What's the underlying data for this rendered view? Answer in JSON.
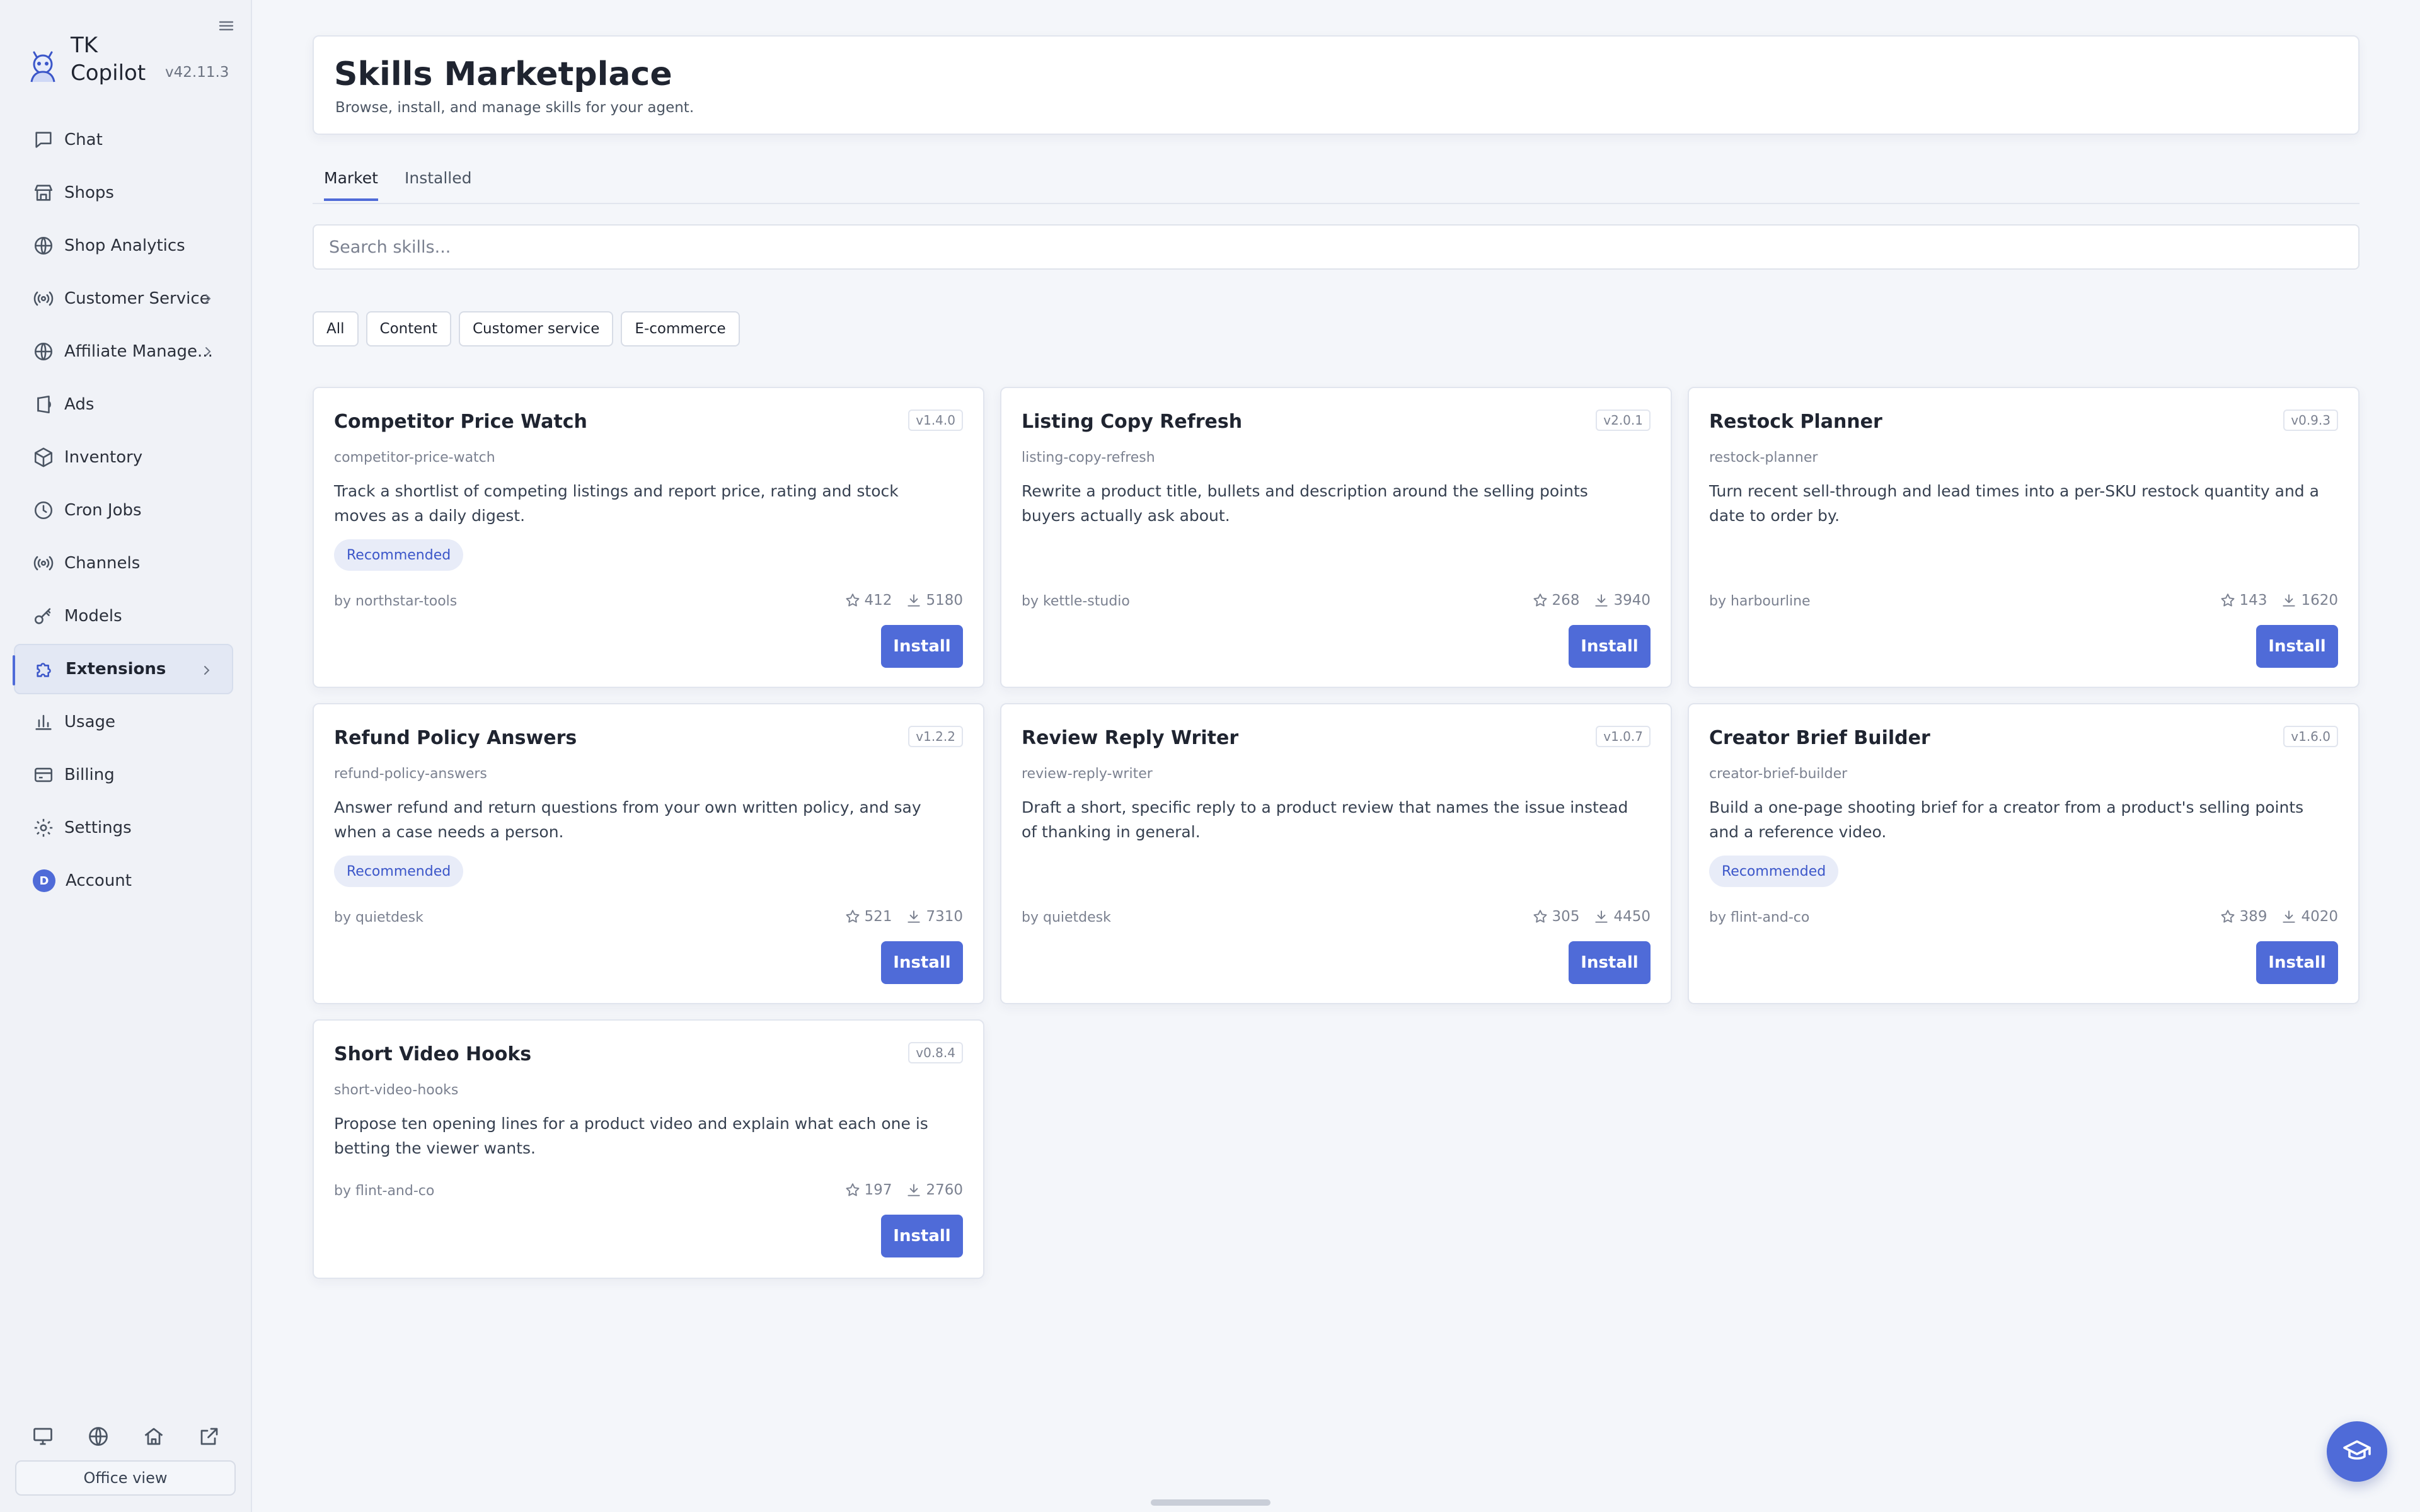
{
  "app": {
    "name": "TK Copilot",
    "version": "v42.11.3"
  },
  "sidebar": {
    "items": [
      {
        "label": "Chat",
        "icon": "chat-bubble-icon"
      },
      {
        "label": "Shops",
        "icon": "storefront-icon"
      },
      {
        "label": "Shop Analytics",
        "icon": "globe-icon"
      },
      {
        "label": "Customer Service",
        "icon": "broadcast-icon",
        "expandable": true
      },
      {
        "label": "Affiliate Manage...",
        "icon": "globe-icon",
        "expandable": true
      },
      {
        "label": "Ads",
        "icon": "megaphone-icon"
      },
      {
        "label": "Inventory",
        "icon": "package-icon"
      },
      {
        "label": "Cron Jobs",
        "icon": "clock-icon"
      },
      {
        "label": "Channels",
        "icon": "broadcast-icon"
      },
      {
        "label": "Models",
        "icon": "key-icon"
      },
      {
        "label": "Extensions",
        "icon": "puzzle-icon",
        "expandable": true,
        "active": true
      },
      {
        "label": "Usage",
        "icon": "bar-chart-icon"
      },
      {
        "label": "Billing",
        "icon": "credit-card-icon"
      },
      {
        "label": "Settings",
        "icon": "gear-icon"
      },
      {
        "label": "Account",
        "icon": "avatar",
        "avatar_initial": "D"
      }
    ],
    "footer_icons": [
      "monitor-icon",
      "globe-icon",
      "home-icon",
      "external-link-icon"
    ],
    "office_view_label": "Office view"
  },
  "header": {
    "title": "Skills Marketplace",
    "subtitle": "Browse, install, and manage skills for your agent."
  },
  "tabs": [
    {
      "label": "Market",
      "active": true
    },
    {
      "label": "Installed",
      "active": false
    }
  ],
  "search": {
    "placeholder": "Search skills...",
    "value": ""
  },
  "filters": [
    "All",
    "Content",
    "Customer service",
    "E-commerce"
  ],
  "cards": [
    {
      "title": "Competitor Price Watch",
      "version": "v1.4.0",
      "slug": "competitor-price-watch",
      "description": "Track a shortlist of competing listings and report price, rating and stock moves as a daily digest.",
      "badge": "Recommended",
      "author": "by northstar-tools",
      "stars": "412",
      "downloads": "5180",
      "button": "Install"
    },
    {
      "title": "Listing Copy Refresh",
      "version": "v2.0.1",
      "slug": "listing-copy-refresh",
      "description": "Rewrite a product title, bullets and description around the selling points buyers actually ask about.",
      "badge": "",
      "author": "by kettle-studio",
      "stars": "268",
      "downloads": "3940",
      "button": "Install"
    },
    {
      "title": "Restock Planner",
      "version": "v0.9.3",
      "slug": "restock-planner",
      "description": "Turn recent sell-through and lead times into a per-SKU restock quantity and a date to order by.",
      "badge": "",
      "author": "by harbourline",
      "stars": "143",
      "downloads": "1620",
      "button": "Install"
    },
    {
      "title": "Refund Policy Answers",
      "version": "v1.2.2",
      "slug": "refund-policy-answers",
      "description": "Answer refund and return questions from your own written policy, and say when a case needs a person.",
      "badge": "Recommended",
      "author": "by quietdesk",
      "stars": "521",
      "downloads": "7310",
      "button": "Install"
    },
    {
      "title": "Review Reply Writer",
      "version": "v1.0.7",
      "slug": "review-reply-writer",
      "description": "Draft a short, specific reply to a product review that names the issue instead of thanking in general.",
      "badge": "",
      "author": "by quietdesk",
      "stars": "305",
      "downloads": "4450",
      "button": "Install"
    },
    {
      "title": "Creator Brief Builder",
      "version": "v1.6.0",
      "slug": "creator-brief-builder",
      "description": "Build a one-page shooting brief for a creator from a product's selling points and a reference video.",
      "badge": "Recommended",
      "author": "by flint-and-co",
      "stars": "389",
      "downloads": "4020",
      "button": "Install"
    },
    {
      "title": "Short Video Hooks",
      "version": "v0.8.4",
      "slug": "short-video-hooks",
      "description": "Propose ten opening lines for a product video and explain what each one is betting the viewer wants.",
      "badge": "",
      "author": "by flint-and-co",
      "stars": "197",
      "downloads": "2760",
      "button": "Install"
    }
  ],
  "colors": {
    "accent": "#4f6bd8",
    "badge_bg": "#e8ecf8",
    "badge_text": "#3b56c9",
    "sidebar_bg": "#f0f2f7",
    "page_bg": "#f4f6fa"
  },
  "help_button_icon": "graduation-cap-icon"
}
